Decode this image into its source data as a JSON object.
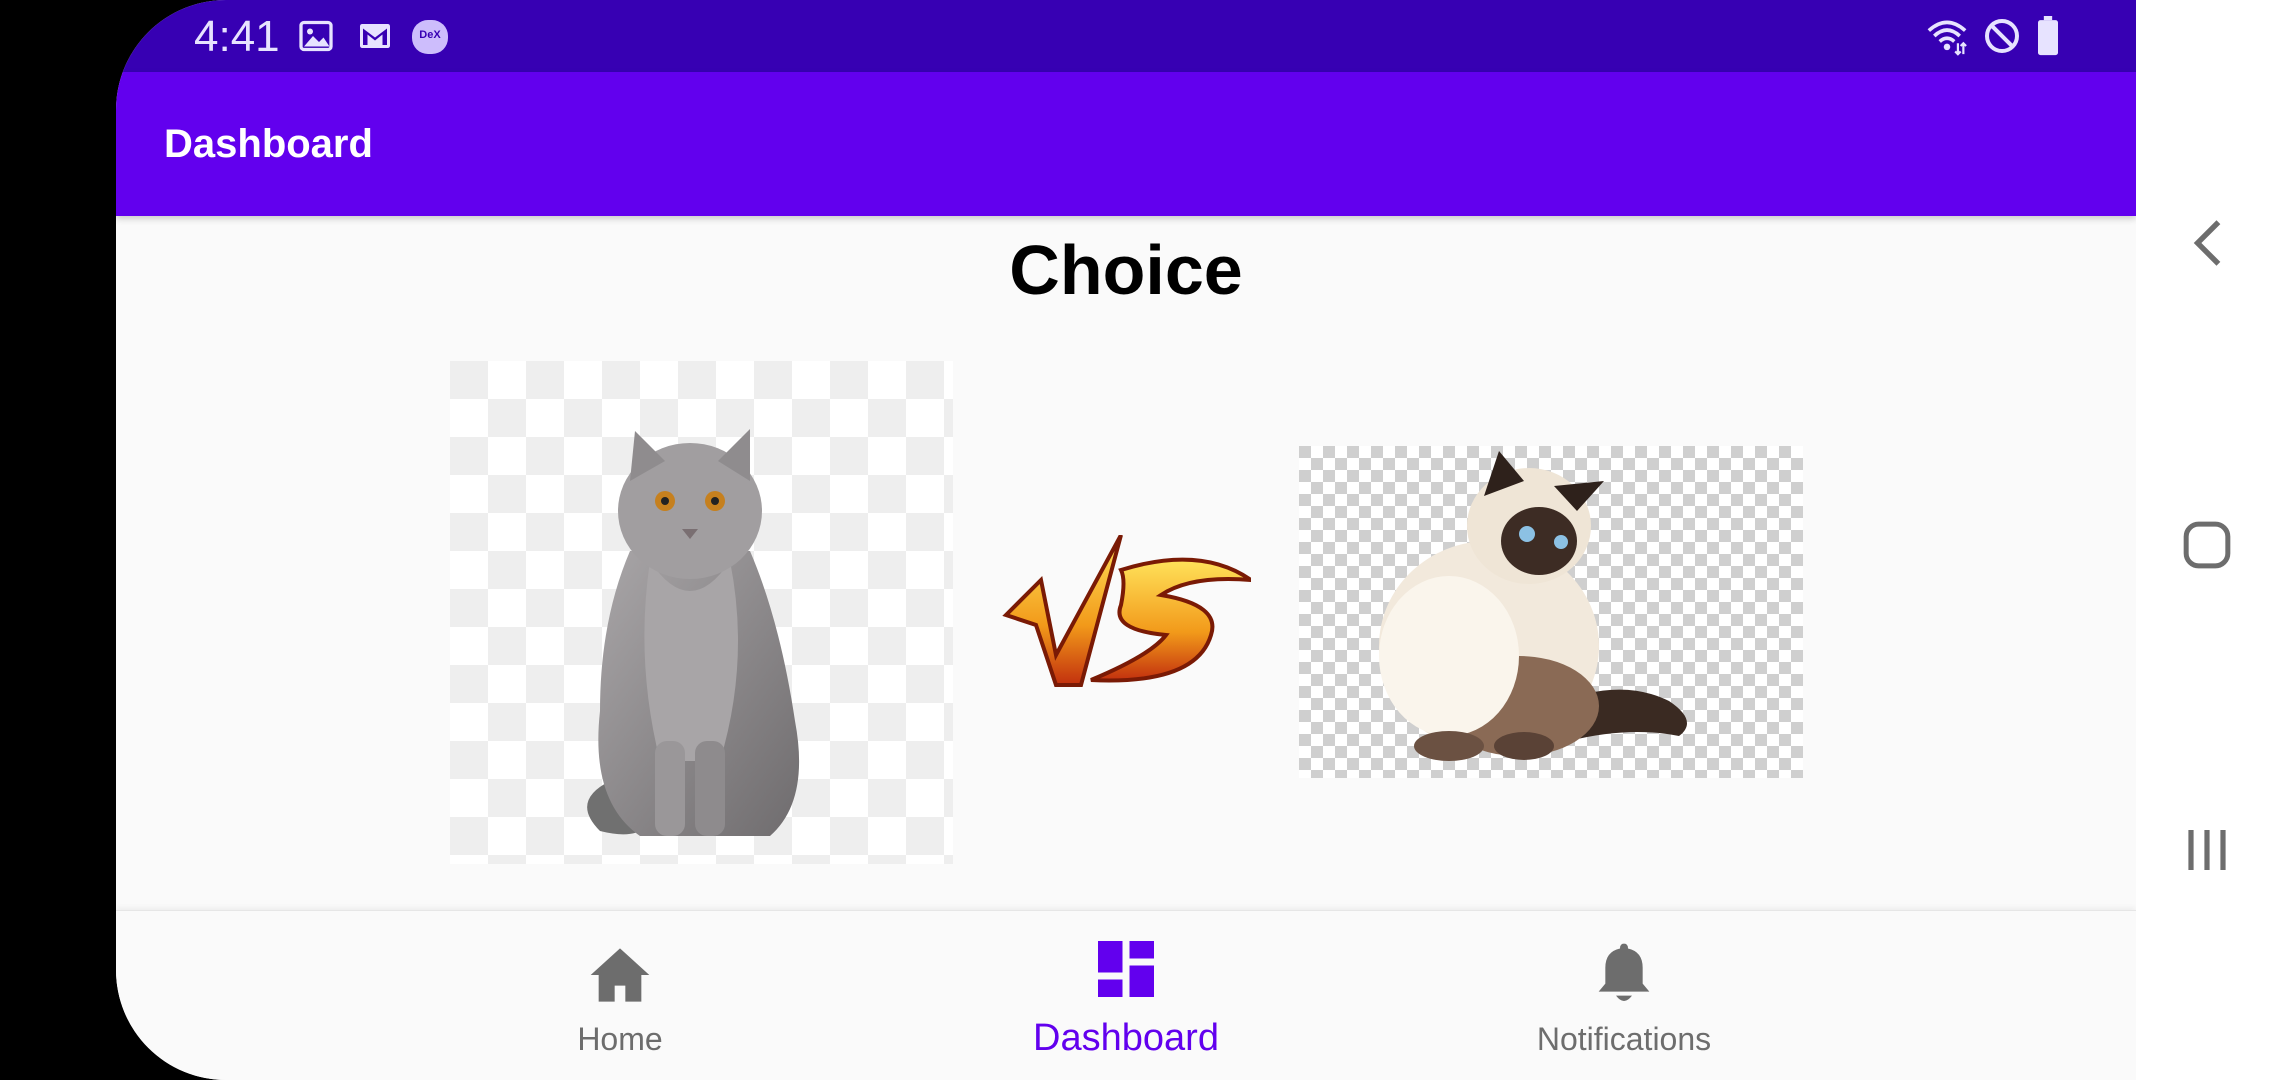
{
  "status_bar": {
    "time": "4:41",
    "notification_icons": [
      "gallery-icon",
      "gmail-icon",
      "dex-icon"
    ],
    "dex_label": "DeX",
    "system_icons": [
      "wifi-icon",
      "do-not-disturb-icon",
      "battery-icon"
    ]
  },
  "app_bar": {
    "title": "Dashboard"
  },
  "main": {
    "heading": "Choice",
    "images": [
      "grey-cat-image",
      "vs-logo",
      "himalayan-cat-image"
    ]
  },
  "bottom_nav": {
    "items": [
      {
        "label": "Home",
        "icon": "home-icon",
        "active": false
      },
      {
        "label": "Dashboard",
        "icon": "dashboard-icon",
        "active": true
      },
      {
        "label": "Notifications",
        "icon": "bell-icon",
        "active": false
      }
    ]
  },
  "system_nav": {
    "buttons": [
      "back-icon",
      "home-square-icon",
      "recents-icon"
    ]
  },
  "colors": {
    "primary": "#6200ee",
    "primary_dark": "#3700b3",
    "inactive": "#6d6d6d"
  }
}
